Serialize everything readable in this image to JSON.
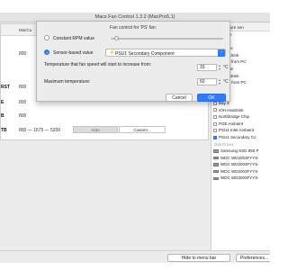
{
  "window": {
    "title": "Macs Fan Control 1.3.2 (MacPro5,1)"
  },
  "fans": {
    "header_min_rpm": "Min/Cu",
    "rows": [
      {
        "name": "",
        "rpm": "800"
      },
      {
        "name": "RST",
        "rpm": "800"
      },
      {
        "name": "E",
        "rpm": "800"
      },
      {
        "name": "B",
        "rpm": "800"
      },
      {
        "name": "TB",
        "rpm": "800 — 1675 — 5200"
      }
    ],
    "last_row_controls": {
      "auto": "Auto",
      "custom": "Custom..."
    }
  },
  "sensors": {
    "header": "Temperature sen",
    "items": [
      {
        "type": "item",
        "label": "Sensor",
        "checked": false
      },
      {
        "type": "item",
        "label": "mbient",
        "checked": false
      },
      {
        "type": "item",
        "label": "A Diode",
        "checked": false
      },
      {
        "type": "item",
        "label": "A HeatSink",
        "checked": false
      },
      {
        "type": "item",
        "label": "A core from PC",
        "checked": false
      },
      {
        "type": "item",
        "label": "B Diode",
        "checked": false
      },
      {
        "type": "item",
        "label": "B HeatSink",
        "checked": false
      },
      {
        "type": "item",
        "label": "B core from PC",
        "checked": false
      },
      {
        "type": "item",
        "label": "Bay 1",
        "checked": false
      },
      {
        "type": "item",
        "label": "Bay 2",
        "checked": false
      },
      {
        "type": "item",
        "label": "Bay 3",
        "checked": false
      },
      {
        "type": "item",
        "label": "IOH HeatSink",
        "checked": false
      },
      {
        "type": "item",
        "label": "Northbridge Chip",
        "checked": false
      },
      {
        "type": "item",
        "label": "POE Ambient",
        "checked": false
      },
      {
        "type": "item",
        "label": "PSU1 Inlet Ambient",
        "checked": false
      },
      {
        "type": "item",
        "label": "PSU1 Secondary Co",
        "checked": true
      },
      {
        "type": "group",
        "label": "Disk Drives"
      },
      {
        "type": "drive",
        "label": "Samsung SSD 850 P"
      },
      {
        "type": "drive",
        "label": "WDC WD2003FYYS-"
      },
      {
        "type": "drive",
        "label": "WDC WD2003FYYS-"
      },
      {
        "type": "drive",
        "label": "WDC WD2003FYYS-"
      },
      {
        "type": "drive",
        "label": "WDC WD2003FYYS-"
      }
    ]
  },
  "dialog": {
    "title": "Fan control for 'PS' fan:",
    "constant_rpm_label": "Constant RPM value",
    "sensor_based_label": "Sensor-based value",
    "sensor_icon": "lightning-icon",
    "selected_sensor": "PSU1 Secondary Component",
    "start_label": "Temperature that fan speed will start to increase from:",
    "start_value": "33",
    "max_label": "Maximum temperature:",
    "max_value": "60",
    "unit": "°C",
    "cancel_label": "Cancel",
    "ok_label": "OK"
  },
  "bottom": {
    "hide_label": "Hide to menu bar",
    "preferences_label": "Preferences..."
  },
  "colors": {
    "accent": "#2f7cf6"
  }
}
